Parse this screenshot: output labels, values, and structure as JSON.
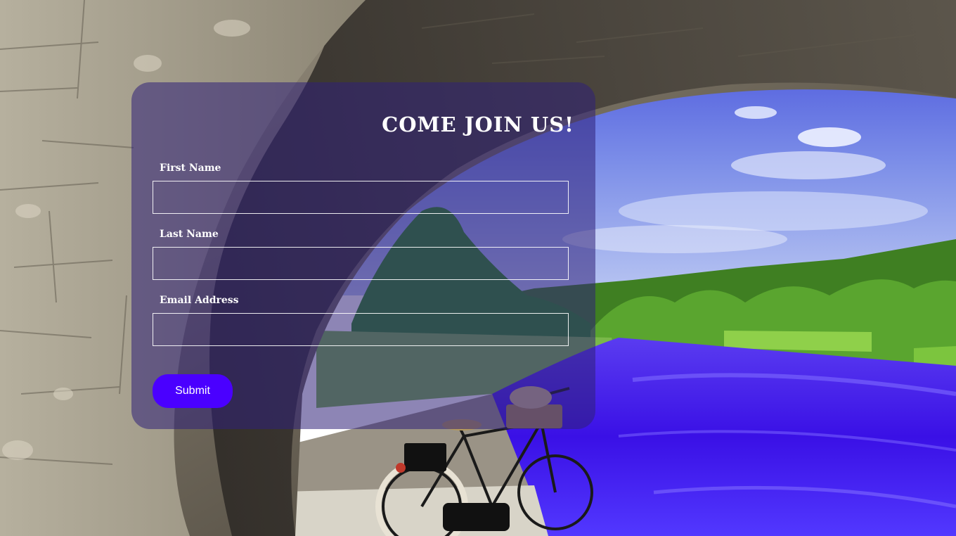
{
  "form": {
    "title": "COME JOIN US!",
    "fields": [
      {
        "label": "First Name",
        "value": "",
        "placeholder": ""
      },
      {
        "label": "Last Name",
        "value": "",
        "placeholder": ""
      },
      {
        "label": "Email Address",
        "value": "",
        "placeholder": ""
      }
    ],
    "submit_label": "Submit"
  },
  "colors": {
    "card_tint": "#302078",
    "submit_button": "#4a00ff",
    "text": "#ffffff",
    "sky": "#3e4fe0",
    "river": "#3a10e6",
    "foliage": "#4f9a2a",
    "stone": "#6b6457"
  }
}
